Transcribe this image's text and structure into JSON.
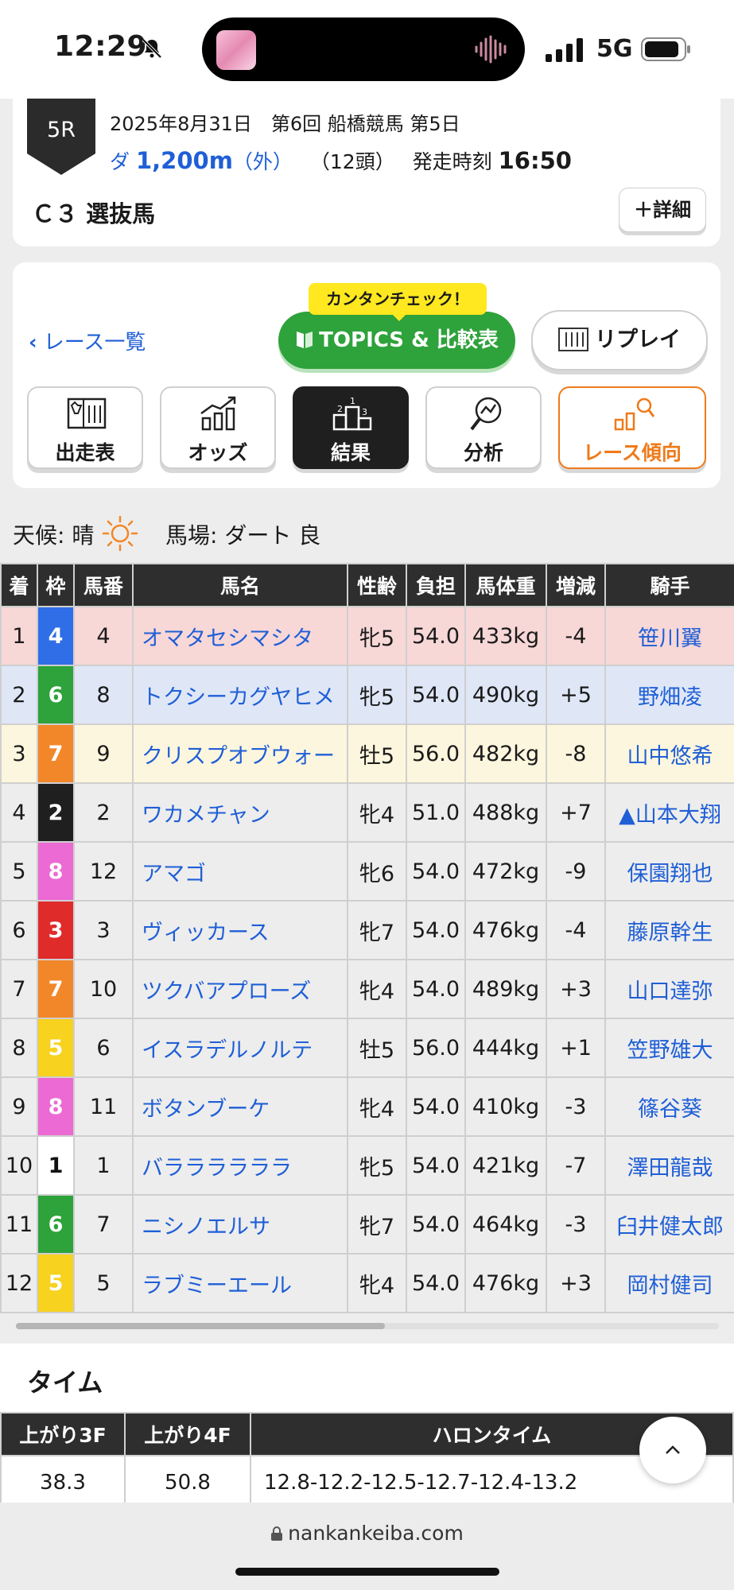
{
  "status_bar": {
    "time": "12:29",
    "network": "5G"
  },
  "race": {
    "number": "5R",
    "date_line": "2025年8月31日　第6回 船橋競馬 第5日",
    "surface": "ダ",
    "distance": "1,200m",
    "course": "（外）",
    "heads": "（12頭）",
    "post_time_label": "発走時刻",
    "post_time": "16:50",
    "name": "Ｃ３ 選抜馬",
    "detail_button": "＋詳細"
  },
  "nav": {
    "back_link": "レース一覧",
    "tooltip": "カンタンチェック！",
    "topics_button": "TOPICS & 比較表",
    "replay_button": "リプレイ",
    "tabs": [
      {
        "label": "出走表",
        "icon": "entry-list-icon"
      },
      {
        "label": "オッズ",
        "icon": "odds-chart-icon"
      },
      {
        "label": "結果",
        "icon": "podium-icon"
      },
      {
        "label": "分析",
        "icon": "analysis-icon"
      },
      {
        "label": "レース傾向",
        "icon": "trend-icon"
      }
    ]
  },
  "conditions": {
    "weather_label": "天候: 晴",
    "track_label": "馬場: ダート 良"
  },
  "results": {
    "headers": [
      "着",
      "枠",
      "馬番",
      "馬名",
      "性齢",
      "負担",
      "馬体重",
      "増減",
      "騎手"
    ],
    "rows": [
      {
        "pos": "1",
        "waku": "4",
        "num": "4",
        "name": "オマタセシマシタ",
        "sexage": "牝5",
        "weight": "54.0",
        "body": "433kg",
        "diff": "-4",
        "jockey": "笹川翼"
      },
      {
        "pos": "2",
        "waku": "6",
        "num": "8",
        "name": "トクシーカグヤヒメ",
        "sexage": "牝5",
        "weight": "54.0",
        "body": "490kg",
        "diff": "+5",
        "jockey": "野畑凌"
      },
      {
        "pos": "3",
        "waku": "7",
        "num": "9",
        "name": "クリスプオブウォー",
        "sexage": "牡5",
        "weight": "56.0",
        "body": "482kg",
        "diff": "-8",
        "jockey": "山中悠希"
      },
      {
        "pos": "4",
        "waku": "2",
        "num": "2",
        "name": "ワカメチャン",
        "sexage": "牝4",
        "weight": "51.0",
        "body": "488kg",
        "diff": "+7",
        "jockey": "▲山本大翔"
      },
      {
        "pos": "5",
        "waku": "8",
        "num": "12",
        "name": "アマゴ",
        "sexage": "牝6",
        "weight": "54.0",
        "body": "472kg",
        "diff": "-9",
        "jockey": "保園翔也"
      },
      {
        "pos": "6",
        "waku": "3",
        "num": "3",
        "name": "ヴィッカース",
        "sexage": "牝7",
        "weight": "54.0",
        "body": "476kg",
        "diff": "-4",
        "jockey": "藤原幹生"
      },
      {
        "pos": "7",
        "waku": "7",
        "num": "10",
        "name": "ツクバアプローズ",
        "sexage": "牝4",
        "weight": "54.0",
        "body": "489kg",
        "diff": "+3",
        "jockey": "山口達弥"
      },
      {
        "pos": "8",
        "waku": "5",
        "num": "6",
        "name": "イスラデルノルテ",
        "sexage": "牡5",
        "weight": "56.0",
        "body": "444kg",
        "diff": "+1",
        "jockey": "笠野雄大"
      },
      {
        "pos": "9",
        "waku": "8",
        "num": "11",
        "name": "ボタンブーケ",
        "sexage": "牝4",
        "weight": "54.0",
        "body": "410kg",
        "diff": "-3",
        "jockey": "篠谷葵"
      },
      {
        "pos": "10",
        "waku": "1",
        "num": "1",
        "name": "バララララララ",
        "sexage": "牝5",
        "weight": "54.0",
        "body": "421kg",
        "diff": "-7",
        "jockey": "澤田龍哉"
      },
      {
        "pos": "11",
        "waku": "6",
        "num": "7",
        "name": "ニシノエルサ",
        "sexage": "牝7",
        "weight": "54.0",
        "body": "464kg",
        "diff": "-3",
        "jockey": "臼井健太郎"
      },
      {
        "pos": "12",
        "waku": "5",
        "num": "5",
        "name": "ラブミーエール",
        "sexage": "牝4",
        "weight": "54.0",
        "body": "476kg",
        "diff": "+3",
        "jockey": "岡村健司"
      }
    ]
  },
  "waku_colors": {
    "1": "#ffffff",
    "2": "#1f1f1f",
    "3": "#e02b2b",
    "4": "#2f6ee6",
    "5": "#f7d21e",
    "6": "#2ea23b",
    "7": "#f2872a",
    "8": "#ec6ad3"
  },
  "time": {
    "title": "タイム",
    "headers": [
      "上がり3F",
      "上がり4F",
      "ハロンタイム"
    ],
    "row": [
      "38.3",
      "50.8",
      "12.8-12.2-12.5-12.7-12.4-13.2"
    ]
  },
  "browser": {
    "url": "nankankeiba.com"
  }
}
